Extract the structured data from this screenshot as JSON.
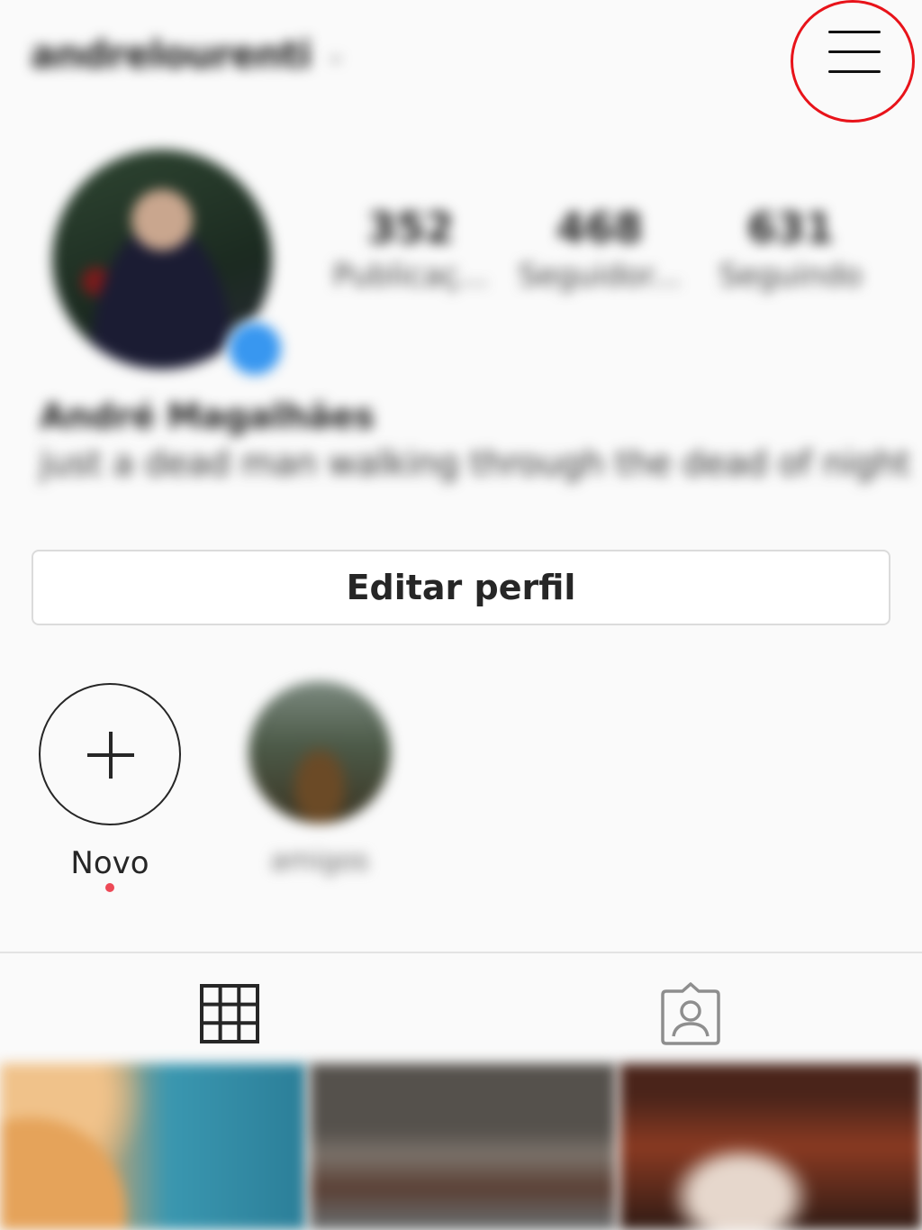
{
  "header": {
    "username": "andrelourenti",
    "caret": "⌄",
    "menu_icon": "hamburger-menu-icon",
    "highlight_color": "#e8131a"
  },
  "profile": {
    "stats": [
      {
        "value": "352",
        "label": "Publicaç..."
      },
      {
        "value": "468",
        "label": "Seguidor..."
      },
      {
        "value": "631",
        "label": "Seguindo"
      }
    ],
    "full_name": "André Magalhães",
    "bio": "just a dead man walking through the dead of night"
  },
  "actions": {
    "edit_profile": "Editar perfil"
  },
  "highlights": [
    {
      "label": "Novo",
      "icon": "plus-icon"
    },
    {
      "label": "amigos"
    }
  ],
  "tabs": [
    {
      "icon": "grid-icon"
    },
    {
      "icon": "tagged-user-icon"
    }
  ],
  "colors": {
    "background": "#fafafa",
    "avatar_badge": "#3897f0",
    "notification_dot": "#ed4956"
  }
}
